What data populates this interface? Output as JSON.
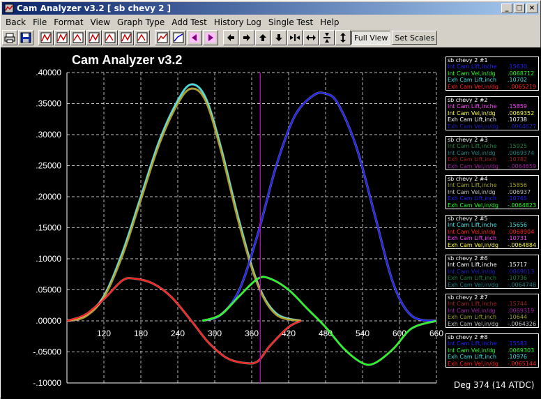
{
  "window": {
    "title": "Cam Analyzer v3.2   [ sb chevy 2 ]"
  },
  "menu": [
    "Back",
    "File",
    "Format",
    "View",
    "Graph Type",
    "Add Test",
    "History Log",
    "Single Test",
    "Help"
  ],
  "toolbar": {
    "full_view": "Full View",
    "set_scales": "Set Scales",
    "icons": [
      "printer-icon",
      "save-icon",
      "chart-view-1-icon",
      "chart-view-2-icon",
      "chart-view-3-icon",
      "chart-view-4-icon",
      "chart-view-5-icon",
      "chart-view-6-icon",
      "chart-view-7-icon",
      "chart-line-icon",
      "chart-up-icon",
      "prev-icon",
      "next-icon",
      "arrow-left-icon",
      "arrow-right-icon",
      "arrow-up-icon",
      "arrow-down-icon",
      "compress-horizontal-icon",
      "expand-horizontal-icon",
      "compress-vertical-icon",
      "expand-vertical-icon"
    ]
  },
  "graph": {
    "title": "Cam Analyzer v3.2",
    "cursor_readout": "Deg    374 (14 ATDC)"
  },
  "chart_data": {
    "type": "line",
    "title": "Cam Analyzer v3.2",
    "xlabel": "",
    "ylabel": "",
    "xlim": [
      60,
      660
    ],
    "ylim": [
      -0.1,
      0.4
    ],
    "x_ticks": [
      "120",
      "180",
      "240",
      "300",
      "360",
      "420",
      "480",
      "540",
      "600",
      "660"
    ],
    "y_ticks": [
      ".40000",
      ".35000",
      ".30000",
      ".25000",
      ".20000",
      ".15000",
      ".10000",
      ".05000",
      ".00000",
      "-.05000",
      "-.10000"
    ],
    "cursor_x": 374,
    "grid": true,
    "series": [
      {
        "name": "Exh Cam Lift,inch",
        "color": "#40e0e0",
        "x": [
          60,
          90,
          120,
          150,
          180,
          210,
          240,
          262,
          285,
          310,
          340,
          370,
          400,
          440
        ],
        "y": [
          0,
          0.008,
          0.04,
          0.11,
          0.2,
          0.29,
          0.355,
          0.381,
          0.36,
          0.28,
          0.16,
          0.06,
          0.012,
          0
        ]
      },
      {
        "name": "Exh Cam Lift,inch",
        "color": "#b0a020",
        "x": [
          60,
          90,
          120,
          150,
          180,
          210,
          240,
          262,
          285,
          310,
          340,
          370,
          400,
          440
        ],
        "y": [
          0,
          0.007,
          0.038,
          0.105,
          0.195,
          0.285,
          0.35,
          0.374,
          0.355,
          0.275,
          0.155,
          0.058,
          0.01,
          0
        ]
      },
      {
        "name": "Int Cam Lift,inche",
        "color": "#2020ff",
        "x": [
          280,
          310,
          340,
          370,
          400,
          430,
          460,
          480,
          500,
          530,
          560,
          590,
          620,
          660
        ],
        "y": [
          0,
          0.01,
          0.05,
          0.14,
          0.25,
          0.33,
          0.363,
          0.366,
          0.35,
          0.28,
          0.17,
          0.06,
          0.008,
          0
        ]
      },
      {
        "name": "Exh Cam Vel,in/dg",
        "color": "#ff2020",
        "x": [
          60,
          90,
          120,
          150,
          170,
          200,
          230,
          262,
          290,
          320,
          350,
          370,
          390,
          420,
          440
        ],
        "y": [
          0,
          0.01,
          0.035,
          0.065,
          0.068,
          0.06,
          0.038,
          0,
          -0.035,
          -0.06,
          -0.068,
          -0.065,
          -0.04,
          -0.01,
          0
        ]
      },
      {
        "name": "Int Cam Vel,in/dg",
        "color": "#20ff20",
        "x": [
          280,
          310,
          340,
          370,
          390,
          420,
          450,
          480,
          510,
          540,
          560,
          590,
          620,
          660
        ],
        "y": [
          0,
          0.01,
          0.04,
          0.068,
          0.068,
          0.05,
          0.02,
          -0.01,
          -0.045,
          -0.068,
          -0.068,
          -0.045,
          -0.012,
          0
        ]
      }
    ]
  },
  "panels": [
    {
      "header": "sb chevy 2 #1",
      "rows": [
        {
          "label": "Int Cam Lift,inche",
          "value": ".15630",
          "color": "#2020ff"
        },
        {
          "label": "Int Cam Vel,in/dg",
          "value": ".0068712",
          "color": "#20ff20"
        },
        {
          "label": "Exh Cam Lift,inch",
          "value": ".10702",
          "color": "#40e0e0"
        },
        {
          "label": "Exh Cam Vel,in/dg",
          "value": "-.0065219",
          "color": "#ff2020"
        }
      ]
    },
    {
      "header": "sb chevy 2 #2",
      "rows": [
        {
          "label": "Int Cam Lift,inche",
          "value": ".15859",
          "color": "#ff40ff"
        },
        {
          "label": "Int Cam Vel,in/dg",
          "value": ".0069352",
          "color": "#ffff40"
        },
        {
          "label": "Exh Cam Lift,inch",
          "value": ".10738",
          "color": "#ffffff"
        },
        {
          "label": "Exh Cam Vel,in/dg",
          "value": "-.0064627",
          "color": "#2020c0"
        }
      ]
    },
    {
      "header": "sb chevy 2 #3",
      "rows": [
        {
          "label": "Int Cam Lift,inche",
          "value": ".15925",
          "color": "#208040"
        },
        {
          "label": "Int Cam Vel,in/dg",
          "value": ".0069374",
          "color": "#208080"
        },
        {
          "label": "Exh Cam Lift,inch",
          "value": ".10782",
          "color": "#a02020"
        },
        {
          "label": "Exh Cam Vel,in/dg",
          "value": "-.0064659",
          "color": "#a020a0"
        }
      ]
    },
    {
      "header": "sb chevy 2 #4",
      "rows": [
        {
          "label": "Int Cam Lift,inche",
          "value": ".15856",
          "color": "#a0a020"
        },
        {
          "label": "Int Cam Vel,in/dg",
          "value": ".006937",
          "color": "#c0c0c0"
        },
        {
          "label": "Exh Cam Lift,inch",
          "value": ".10765",
          "color": "#2020ff"
        },
        {
          "label": "Exh Cam Vel,in/dg",
          "value": "-.0064823",
          "color": "#20ff20"
        }
      ]
    },
    {
      "header": "sb chevy 2 #5",
      "rows": [
        {
          "label": "Int Cam Lift,inche",
          "value": ".15656",
          "color": "#40e0e0"
        },
        {
          "label": "Int Cam Vel,in/dg",
          "value": ".0068904",
          "color": "#ff2020"
        },
        {
          "label": "Exh Cam Lift,inch",
          "value": ".10731",
          "color": "#ff40ff"
        },
        {
          "label": "Exh Cam Vel,in/dg",
          "value": "-.0064884",
          "color": "#ffff40"
        }
      ]
    },
    {
      "header": "sb chevy 2 #6",
      "rows": [
        {
          "label": "Int Cam Lift,inche",
          "value": ".15717",
          "color": "#ffffff"
        },
        {
          "label": "Int Cam Vel,in/dg",
          "value": ".0069013",
          "color": "#2020c0"
        },
        {
          "label": "Exh Cam Lift,inch",
          "value": ".10736",
          "color": "#208040"
        },
        {
          "label": "Exh Cam Vel,in/dg",
          "value": "-.0064748",
          "color": "#208080"
        }
      ]
    },
    {
      "header": "sb chevy 2 #7",
      "rows": [
        {
          "label": "Int Cam Lift,inche",
          "value": ".15744",
          "color": "#a02020"
        },
        {
          "label": "Int Cam Vel,in/dg",
          "value": ".0069319",
          "color": "#a020a0"
        },
        {
          "label": "Exh Cam Lift,inch",
          "value": ".10644",
          "color": "#a0a020"
        },
        {
          "label": "Exh Cam Vel,in/dg",
          "value": "-.0064326",
          "color": "#c0c0c0"
        }
      ]
    },
    {
      "header": "sb chevy 2 #8",
      "rows": [
        {
          "label": "Int Cam Lift,inche",
          "value": ".15583",
          "color": "#2020ff"
        },
        {
          "label": "Int Cam Vel,in/dg",
          "value": ".0069303",
          "color": "#20ff20"
        },
        {
          "label": "Exh Cam Lift,inch",
          "value": ".10976",
          "color": "#40e0e0"
        },
        {
          "label": "Exh Cam Vel,in/dg",
          "value": "-.0065144",
          "color": "#ff2020"
        }
      ]
    }
  ]
}
